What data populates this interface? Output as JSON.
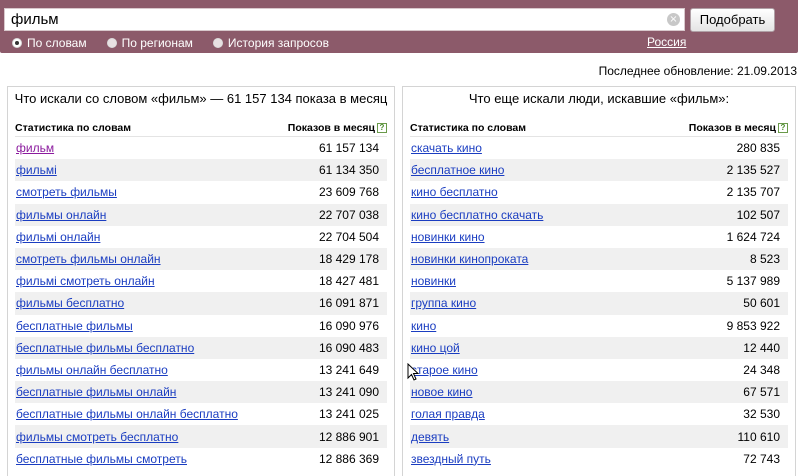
{
  "search": {
    "query": "фильм",
    "clear_symbol": "×",
    "submit_label": "Подобрать",
    "modes": [
      {
        "label": "По словам",
        "checked": true
      },
      {
        "label": "По регионам",
        "checked": false
      },
      {
        "label": "История запросов",
        "checked": false
      }
    ],
    "region": "Россия"
  },
  "last_update": "Последнее обновление: 21.09.2013",
  "left_panel": {
    "title": "Что искали со словом «фильм» — 61 157 134 показа в месяц",
    "col_word": "Статистика по словам",
    "col_count": "Показов в месяц",
    "help_symbol": "?",
    "rows": [
      {
        "phrase": "фильм",
        "count": "61 157 134"
      },
      {
        "phrase": "фильмі",
        "count": "61 134 350"
      },
      {
        "phrase": "смотреть фильмы",
        "count": "23 609 768"
      },
      {
        "phrase": "фильмы онлайн",
        "count": "22 707 038"
      },
      {
        "phrase": "фильмі онлайн",
        "count": "22 704 504"
      },
      {
        "phrase": "смотреть фильмы онлайн",
        "count": "18 429 178"
      },
      {
        "phrase": "фильмі смотреть онлайн",
        "count": "18 427 481"
      },
      {
        "phrase": "фильмы бесплатно",
        "count": "16 091 871"
      },
      {
        "phrase": "бесплатные фильмы",
        "count": "16 090 976"
      },
      {
        "phrase": "бесплатные фильмы бесплатно",
        "count": "16 090 483"
      },
      {
        "phrase": "фильмы онлайн бесплатно",
        "count": "13 241 649"
      },
      {
        "phrase": "бесплатные фильмы онлайн",
        "count": "13 241 090"
      },
      {
        "phrase": "бесплатные фильмы онлайн бесплатно",
        "count": "13 241 025"
      },
      {
        "phrase": "фильмы смотреть бесплатно",
        "count": "12 886 901"
      },
      {
        "phrase": "бесплатные фильмы смотреть",
        "count": "12 886 369"
      }
    ]
  },
  "right_panel": {
    "title": "Что еще искали люди, искавшие «фильм»:",
    "col_word": "Статистика по словам",
    "col_count": "Показов в месяц",
    "help_symbol": "?",
    "rows": [
      {
        "phrase": "скачать кино",
        "count": "280 835"
      },
      {
        "phrase": "бесплатное кино",
        "count": "2 135 527"
      },
      {
        "phrase": "кино бесплатно",
        "count": "2 135 707"
      },
      {
        "phrase": "кино бесплатно скачать",
        "count": "102 507"
      },
      {
        "phrase": "новинки кино",
        "count": "1 624 724"
      },
      {
        "phrase": "новинки кинопроката",
        "count": "8 523"
      },
      {
        "phrase": "новинки",
        "count": "5 137 989"
      },
      {
        "phrase": "группа кино",
        "count": "50 601"
      },
      {
        "phrase": "кино",
        "count": "9 853 922"
      },
      {
        "phrase": "кино цой",
        "count": "12 440"
      },
      {
        "phrase": "старое кино",
        "count": "24 348"
      },
      {
        "phrase": "новое кино",
        "count": "67 571"
      },
      {
        "phrase": "голая правда",
        "count": "32 530"
      },
      {
        "phrase": "девять",
        "count": "110 610"
      },
      {
        "phrase": "звездный путь",
        "count": "72 743"
      }
    ]
  },
  "colors": {
    "topbar": "#8c5a6a",
    "link": "#1a3dc1",
    "visited_link": "#8b1a9e",
    "row_stripe": "#f0f0f0"
  }
}
